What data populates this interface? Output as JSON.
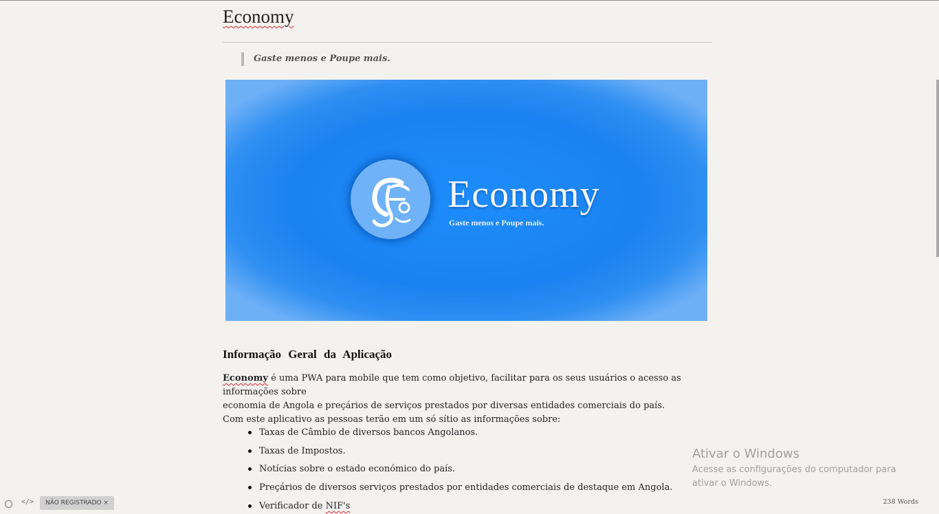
{
  "document": {
    "title": "Economy",
    "blockquote": "Gaste menos e Poupe mais.",
    "hero_image": {
      "brand": "Economy",
      "tagline": "Gaste menos e Poupe mais.",
      "colors": {
        "background": "#1a82f0",
        "circle": "#6fb2f7",
        "text": "#f4f6fb"
      }
    },
    "section_heading": "Informação Geral da Aplicação",
    "intro": {
      "brand_word": "Economy",
      "line1_rest": " é uma PWA para mobile que tem como objetivo, facilitar para os seus usuários o acesso as informações sobre",
      "line2": "economia de Angola e preçários de serviços prestados por diversas entidades comerciais do país.",
      "line3": "Com este aplicativo as pessoas terão em um só sítio as informações sobre:"
    },
    "features": [
      "Taxas de Câmbio de diversos bancos Angolanos.",
      "Taxas de Impostos.",
      "Notícias sobre o estado económico do país.",
      "Preçários de diversos serviços prestados por entidades comerciais de destaque em Angola."
    ],
    "last_feature": {
      "prefix": "Verificador de ",
      "term": "NIF's"
    }
  },
  "watermark": {
    "title": "Ativar o Windows",
    "line1": "Acesse as configurações do computador para",
    "line2": "ativar o Windows."
  },
  "statusbar": {
    "source_icon": "</>",
    "badge": "NÃO REGISTRADO ×",
    "word_count": "238 Words"
  }
}
